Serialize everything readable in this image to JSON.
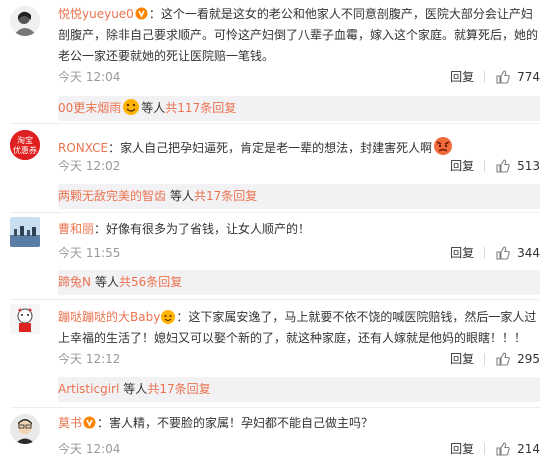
{
  "comments": [
    {
      "user": "悦悦yueyue0",
      "text": "：这个一看就是这女的老公和他家人不同意剖腹产，医院大部分会让产妇剖腹产，除非自己要求顺产。可怜这产妇倒了八辈子血霉，嫁入这个家庭。就算死后，她的老公一家还要就她的死让医院赔一笔钱。",
      "time": "今天 12:04",
      "reply_label": "回复",
      "likes": "774",
      "replies": {
        "name": "00更末烟雨",
        "mid": "等人",
        "count": "共117条回复"
      }
    },
    {
      "user": "RONXCE",
      "text": "：家人自己把孕妇逼死，肯定是老一辈的想法，封建害死人啊",
      "avatar_lines": [
        "淘宝",
        "优惠券"
      ],
      "time": "今天 12:02",
      "reply_label": "回复",
      "likes": "513",
      "replies": {
        "name": "两颗无敌完美的智齿",
        "mid": "等人",
        "count": "共17条回复"
      }
    },
    {
      "user": "曹和丽",
      "text": "：好像有很多为了省钱，让女人顺产的！",
      "time": "今天 11:55",
      "reply_label": "回复",
      "likes": "344",
      "replies": {
        "name": "蹄兔N",
        "mid": "等人",
        "count": "共56条回复"
      }
    },
    {
      "user": "蹦哒蹦哒的大Baby",
      "text": "：这下家属安逸了，马上就要不依不饶的喊医院赔钱，然后一家人过上幸福的生活了！媳妇又可以娶个新的了，就这种家庭，还有人嫁就是他妈的眼瞎！！！",
      "time": "今天 12:12",
      "reply_label": "回复",
      "likes": "295",
      "replies": {
        "name": "Artisticgirl",
        "mid": "等人",
        "count": "共17条回复"
      }
    },
    {
      "user": "莫书",
      "text": "：害人精，不要脸的家属！孕妇都不能自己做主吗？",
      "time": "今天 12:04",
      "reply_label": "回复",
      "likes": "214"
    }
  ],
  "colors": {
    "accent": "#eb7350",
    "vip": "#ff8400",
    "reply_bg": "#f2f2f5"
  },
  "icons": {
    "like": "thumbs-up-icon",
    "vip": "vip-badge-icon",
    "emoji": "angry-face-emoji"
  }
}
